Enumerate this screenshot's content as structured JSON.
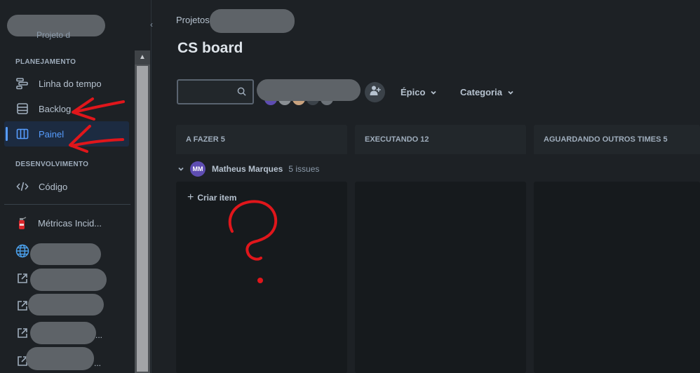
{
  "sidebar": {
    "project_sub": "Projeto d",
    "sections": {
      "planning": "PLANEJAMENTO",
      "development": "DESENVOLVIMENTO"
    },
    "items": {
      "timeline": "Linha do tempo",
      "backlog": "Backlog",
      "board": "Painel",
      "code": "Código",
      "metrics": "Métricas Incid..."
    },
    "ellipsis": "...",
    "icons": [
      "timeline-icon",
      "backlog-icon",
      "board-icon",
      "code-icon",
      "fire-extinguisher-icon",
      "globe-icon",
      "external-link-icon"
    ]
  },
  "header": {
    "breadcrumb": "Projetos",
    "title": "CS board"
  },
  "toolbar": {
    "search_placeholder": "",
    "filters": [
      "Épico",
      "Categoria"
    ]
  },
  "columns": [
    {
      "label": "A FAZER 5"
    },
    {
      "label": "EXECUTANDO 12"
    },
    {
      "label": "AGUARDANDO OUTROS TIMES 5"
    }
  ],
  "swimlane": {
    "initials": "MM",
    "name": "Matheus Marques",
    "count": "5 issues"
  },
  "create_item": "Criar item",
  "colors": {
    "background": "#1d2125",
    "accent": "#579dff",
    "annotation": "#e0161b",
    "avatar": "#5e4db2"
  }
}
